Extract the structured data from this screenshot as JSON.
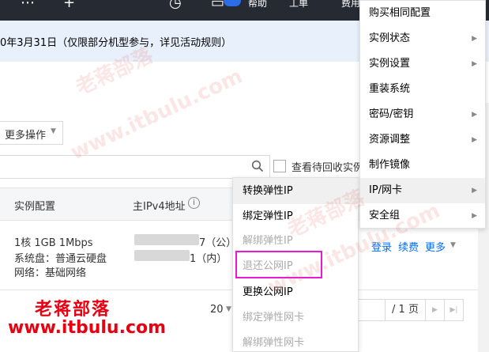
{
  "topbar": {
    "items": [
      {
        "icon": "apps-icon",
        "glyph": "⋯"
      },
      {
        "icon": "plus-icon",
        "glyph": "+"
      },
      {
        "icon": "clock-icon",
        "glyph": "◷"
      },
      {
        "icon": "message-icon",
        "glyph": "▭"
      }
    ],
    "help_label": "帮助",
    "ticket_label": "工单",
    "cost_label": "费用"
  },
  "banner": {
    "text": "0年3月31日（仅限部分机型参与，详见活动规则）"
  },
  "toolbar": {
    "more_ops_label": "更多操作",
    "search_icon": "search-icon",
    "recycle_label": "查看待回收实例"
  },
  "table": {
    "headers": [
      "实例配置",
      "主IPv4地址"
    ],
    "info_icon": "i",
    "row": {
      "config_lines": [
        "1核 1GB 1Mbps",
        "系统盘：普通云硬盘",
        "网络：基础网络"
      ],
      "ip_public_suffix": "7（公）",
      "ip_private_suffix": "1（内）",
      "actions": [
        "登录",
        "续费",
        "更多"
      ]
    }
  },
  "pagination": {
    "page_size": "20",
    "total_pages": "/ 1 页"
  },
  "main_menu": {
    "items": [
      {
        "label": "购买相同配置",
        "has_submenu": false,
        "active": false
      },
      {
        "label": "实例状态",
        "has_submenu": true,
        "active": false
      },
      {
        "label": "实例设置",
        "has_submenu": true,
        "active": false
      },
      {
        "label": "重装系统",
        "has_submenu": false,
        "active": false
      },
      {
        "label": "密码/密钥",
        "has_submenu": true,
        "active": false
      },
      {
        "label": "资源调整",
        "has_submenu": true,
        "active": false
      },
      {
        "label": "制作镜像",
        "has_submenu": false,
        "active": false
      },
      {
        "label": "IP/网卡",
        "has_submenu": true,
        "active": true
      },
      {
        "label": "安全组",
        "has_submenu": true,
        "active": false
      }
    ]
  },
  "ip_submenu": {
    "items": [
      {
        "label": "转换弹性IP",
        "enabled": true,
        "hovered": true
      },
      {
        "label": "绑定弹性IP",
        "enabled": true,
        "hovered": false
      },
      {
        "label": "解绑弹性IP",
        "enabled": false,
        "hovered": false
      },
      {
        "label": "退还公网IP",
        "enabled": false,
        "hovered": false
      },
      {
        "label": "更换公网IP",
        "enabled": true,
        "hovered": false
      },
      {
        "label": "绑定弹性网卡",
        "enabled": false,
        "hovered": false
      },
      {
        "label": "解绑弹性网卡",
        "enabled": false,
        "hovered": false
      }
    ]
  },
  "watermark": {
    "brand": "老蒋部落",
    "url": "www.itbulu.com"
  },
  "colors": {
    "link": "#006eff",
    "highlight_border": "#e51ad2",
    "watermark": "#e60012",
    "topbar_bg": "#262a33",
    "banner_bg": "#e8f0fb"
  }
}
